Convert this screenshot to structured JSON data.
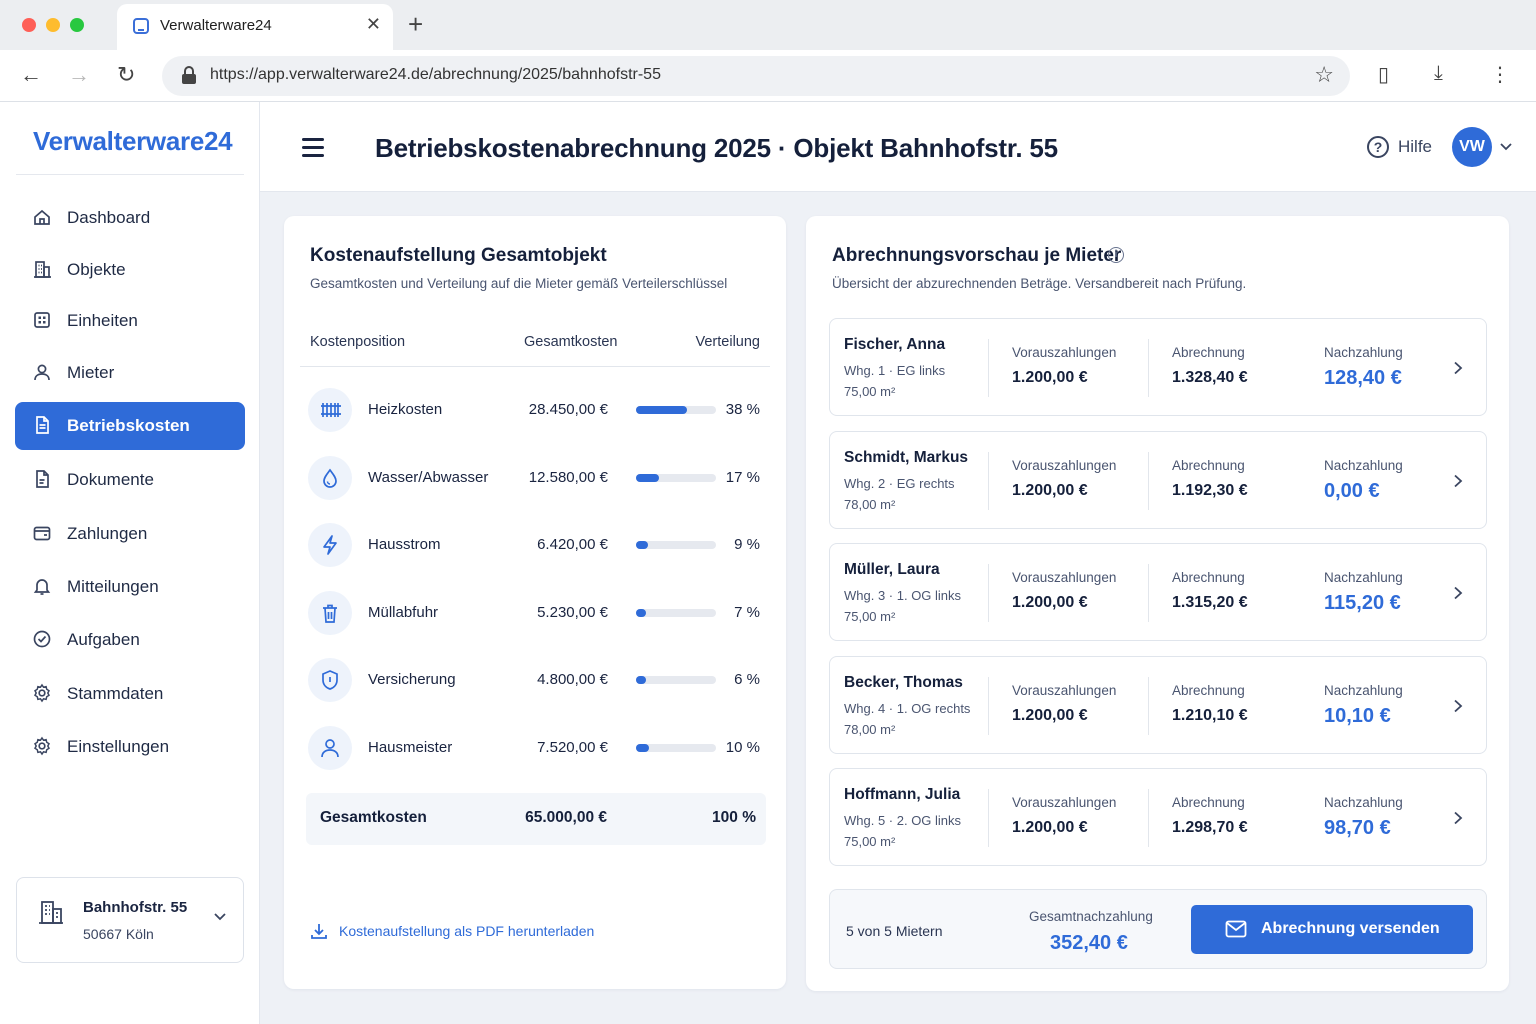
{
  "browser": {
    "tab_title": "Verwalterware24",
    "url": "https://app.verwalterware24.de/abrechnung/2025/bahnhofstr-55"
  },
  "sidebar": {
    "logo": "Verwalterware24",
    "items": [
      {
        "label": "Dashboard",
        "icon": "home-icon"
      },
      {
        "label": "Objekte",
        "icon": "building-icon"
      },
      {
        "label": "Einheiten",
        "icon": "grid-icon"
      },
      {
        "label": "Mieter",
        "icon": "person-icon"
      },
      {
        "label": "Betriebskosten",
        "icon": "document-icon",
        "active": true
      },
      {
        "label": "Dokumente",
        "icon": "file-icon"
      },
      {
        "label": "Zahlungen",
        "icon": "wallet-icon"
      },
      {
        "label": "Mitteilungen",
        "icon": "bell-icon"
      },
      {
        "label": "Aufgaben",
        "icon": "check-circle-icon"
      },
      {
        "label": "Stammdaten",
        "icon": "gear-icon"
      },
      {
        "label": "Einstellungen",
        "icon": "gear-icon"
      }
    ],
    "object": {
      "name": "Bahnhofstr. 55",
      "city": "50667 Köln"
    }
  },
  "header": {
    "title": "Betriebskostenabrechnung 2025 · Objekt Bahnhofstr. 55",
    "help": "Hilfe",
    "avatar": "VW"
  },
  "costs": {
    "title": "Kostenaufstellung Gesamtobjekt",
    "subtitle": "Gesamtkosten und Verteilung auf die Mieter gemäß Verteilerschlüssel",
    "headers": {
      "position": "Kostenposition",
      "total": "Gesamtkosten",
      "share": "Verteilung"
    },
    "rows": [
      {
        "name": "Heizkosten",
        "amount": "28.450,00 €",
        "pct": "38 %",
        "share": 0.38,
        "icon": "radiator-icon"
      },
      {
        "name": "Wasser/Abwasser",
        "amount": "12.580,00 €",
        "pct": "17 %",
        "share": 0.17,
        "icon": "water-drop-icon"
      },
      {
        "name": "Hausstrom",
        "amount": "6.420,00 €",
        "pct": "9 %",
        "share": 0.09,
        "icon": "lightning-icon"
      },
      {
        "name": "Müllabfuhr",
        "amount": "5.230,00 €",
        "pct": "7 %",
        "share": 0.07,
        "icon": "trash-icon"
      },
      {
        "name": "Versicherung",
        "amount": "4.800,00 €",
        "pct": "6 %",
        "share": 0.06,
        "icon": "shield-icon"
      },
      {
        "name": "Hausmeister",
        "amount": "7.520,00 €",
        "pct": "10 %",
        "share": 0.1,
        "icon": "person-icon"
      }
    ],
    "total": {
      "label": "Gesamtkosten",
      "amount": "65.000,00 €",
      "pct": "100 %"
    },
    "download": "Kostenaufstellung als PDF herunterladen"
  },
  "preview": {
    "title": "Abrechnungsvorschau je Mieter",
    "subtitle": "Übersicht der abzurechnenden Beträge. Versandbereit nach Prüfung.",
    "labels": {
      "prepay": "Vorauszahlungen",
      "bill": "Abrechnung",
      "due": "Nachzahlung"
    },
    "tenants": [
      {
        "name": "Fischer, Anna",
        "unit": "Whg. 1 · EG links",
        "size": "75,00 m²",
        "prepay": "1.200,00 €",
        "bill": "1.328,40 €",
        "due": "128,40 €"
      },
      {
        "name": "Schmidt, Markus",
        "unit": "Whg. 2 · EG rechts",
        "size": "78,00 m²",
        "prepay": "1.200,00 €",
        "bill": "1.192,30 €",
        "due": "0,00 €"
      },
      {
        "name": "Müller, Laura",
        "unit": "Whg. 3 · 1. OG links",
        "size": "75,00 m²",
        "prepay": "1.200,00 €",
        "bill": "1.315,20 €",
        "due": "115,20 €"
      },
      {
        "name": "Becker, Thomas",
        "unit": "Whg. 4 · 1. OG rechts",
        "size": "78,00 m²",
        "prepay": "1.200,00 €",
        "bill": "1.210,10 €",
        "due": "10,10 €"
      },
      {
        "name": "Hoffmann, Julia",
        "unit": "Whg. 5 · 2. OG links",
        "size": "75,00 m²",
        "prepay": "1.200,00 €",
        "bill": "1.298,70 €",
        "due": "98,70 €"
      }
    ],
    "footer": {
      "count": "5 von 5 Mietern",
      "total_label": "Gesamtnachzahlung",
      "total_value": "352,40 €",
      "send_label": "Abrechnung versenden"
    }
  },
  "colors": {
    "accent": "#2f6bd8",
    "text": "#15203b",
    "background": "#eef1f6"
  }
}
